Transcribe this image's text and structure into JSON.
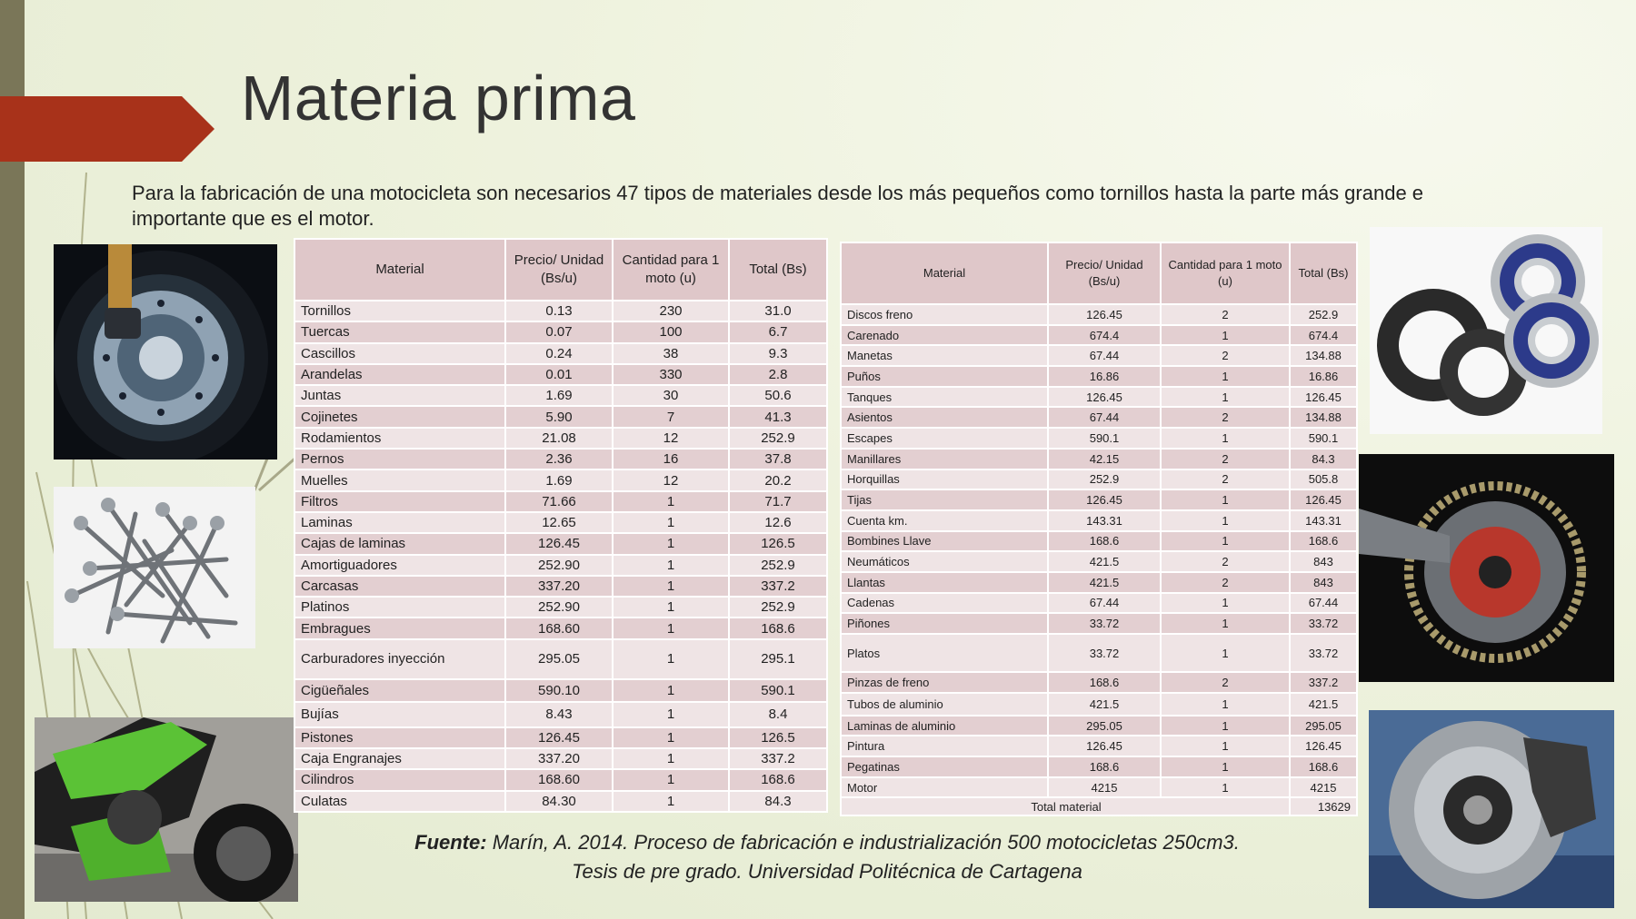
{
  "title": "Materia prima",
  "intro": "Para la fabricación de una motocicleta son necesarios 47 tipos de materiales desde los más pequeños como tornillos hasta la parte más grande e importante que es el motor.",
  "colors": {
    "accent": "#a8321a",
    "header_bg": "#dfc7c9",
    "row_light": "#efe4e5",
    "row_dark": "#e3cfd1",
    "strip": "#7a7658"
  },
  "images": [
    "brake-disc-wheel",
    "screws-pile",
    "green-motorcycle",
    "ball-bearings-seals",
    "chain-sprocket",
    "brake-disc-caliper"
  ],
  "table1": {
    "headers": [
      "Material",
      "Precio/ Unidad (Bs/u)",
      "Cantidad para 1 moto (u)",
      "Total (Bs)"
    ],
    "rows": [
      [
        "Tornillos",
        "0.13",
        "230",
        "31.0"
      ],
      [
        "Tuercas",
        "0.07",
        "100",
        "6.7"
      ],
      [
        "Cascillos",
        "0.24",
        "38",
        "9.3"
      ],
      [
        "Arandelas",
        "0.01",
        "330",
        "2.8"
      ],
      [
        "Juntas",
        "1.69",
        "30",
        "50.6"
      ],
      [
        "Cojinetes",
        "5.90",
        "7",
        "41.3"
      ],
      [
        "Rodamientos",
        "21.08",
        "12",
        "252.9"
      ],
      [
        "Pernos",
        "2.36",
        "16",
        "37.8"
      ],
      [
        "Muelles",
        "1.69",
        "12",
        "20.2"
      ],
      [
        "Filtros",
        "71.66",
        "1",
        "71.7"
      ],
      [
        "Laminas",
        "12.65",
        "1",
        "12.6"
      ],
      [
        "Cajas de laminas",
        "126.45",
        "1",
        "126.5"
      ],
      [
        "Amortiguadores",
        "252.90",
        "1",
        "252.9"
      ],
      [
        "Carcasas",
        "337.20",
        "1",
        "337.2"
      ],
      [
        "Platinos",
        "252.90",
        "1",
        "252.9"
      ],
      [
        "Embragues",
        "168.60",
        "1",
        "168.6"
      ],
      [
        "Carburadores inyección",
        "295.05",
        "1",
        "295.1"
      ],
      [
        "Cigüeñales",
        "590.10",
        "1",
        "590.1"
      ],
      [
        "Bujías",
        "8.43",
        "1",
        "8.4"
      ],
      [
        "Pistones",
        "126.45",
        "1",
        "126.5"
      ],
      [
        "Caja Engranajes",
        "337.20",
        "1",
        "337.2"
      ],
      [
        "Cilindros",
        "168.60",
        "1",
        "168.6"
      ],
      [
        "Culatas",
        "84.30",
        "1",
        "84.3"
      ]
    ]
  },
  "table2": {
    "headers": [
      "Material",
      "Precio/ Unidad (Bs/u)",
      "Cantidad para 1 moto (u)",
      "Total (Bs)"
    ],
    "rows": [
      [
        "Discos freno",
        "126.45",
        "2",
        "252.9"
      ],
      [
        "Carenado",
        "674.4",
        "1",
        "674.4"
      ],
      [
        "Manetas",
        "67.44",
        "2",
        "134.88"
      ],
      [
        "Puños",
        "16.86",
        "1",
        "16.86"
      ],
      [
        "Tanques",
        "126.45",
        "1",
        "126.45"
      ],
      [
        "Asientos",
        "67.44",
        "2",
        "134.88"
      ],
      [
        "Escapes",
        "590.1",
        "1",
        "590.1"
      ],
      [
        "Manillares",
        "42.15",
        "2",
        "84.3"
      ],
      [
        "Horquillas",
        "252.9",
        "2",
        "505.8"
      ],
      [
        "Tijas",
        "126.45",
        "1",
        "126.45"
      ],
      [
        "Cuenta km.",
        "143.31",
        "1",
        "143.31"
      ],
      [
        "Bombines Llave",
        "168.6",
        "1",
        "168.6"
      ],
      [
        "Neumáticos",
        "421.5",
        "2",
        "843"
      ],
      [
        "Llantas",
        "421.5",
        "2",
        "843"
      ],
      [
        "Cadenas",
        "67.44",
        "1",
        "67.44"
      ],
      [
        "Piñones",
        "33.72",
        "1",
        "33.72"
      ],
      [
        "Platos",
        "33.72",
        "1",
        "33.72"
      ],
      [
        "Pinzas de freno",
        "168.6",
        "2",
        "337.2"
      ],
      [
        "Tubos de aluminio",
        "421.5",
        "1",
        "421.5"
      ],
      [
        "Laminas de aluminio",
        "295.05",
        "1",
        "295.05"
      ],
      [
        "Pintura",
        "126.45",
        "1",
        "126.45"
      ],
      [
        "Pegatinas",
        "168.6",
        "1",
        "168.6"
      ],
      [
        "Motor",
        "4215",
        "1",
        "4215"
      ]
    ],
    "total_label": "Total material",
    "total_value": "13629"
  },
  "source": {
    "label": "Fuente:",
    "line1": " Marín, A. 2014. Proceso de fabricación e industrialización 500 motocicletas 250cm3.",
    "line2": "Tesis de pre grado. Universidad Politécnica de Cartagena"
  }
}
